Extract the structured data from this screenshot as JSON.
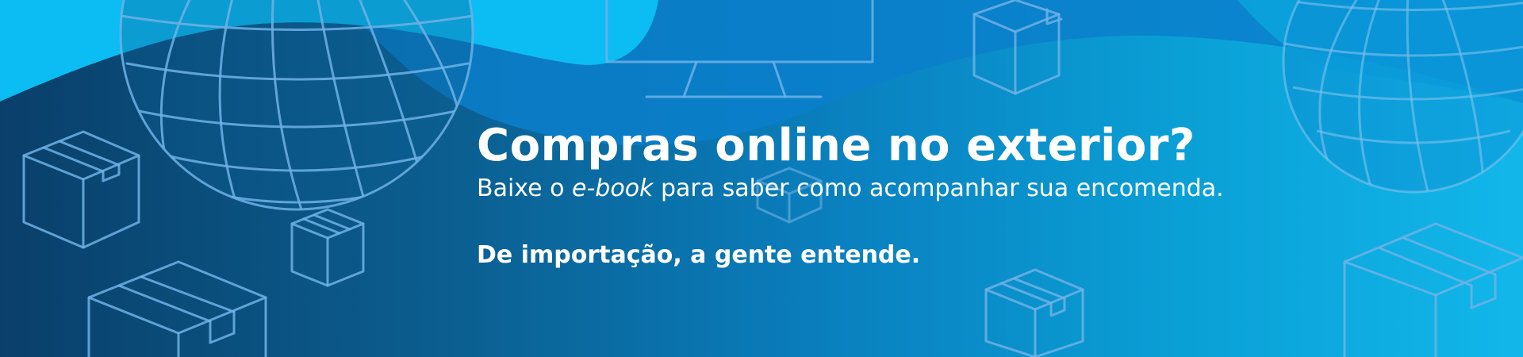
{
  "banner": {
    "headline": "Compras online no exterior?",
    "subtitle": {
      "before": "Baixe o ",
      "emphasis": "e-book",
      "after": " para saber como acompanhar sua encomenda."
    },
    "tagline": "De importação, a gente entende."
  },
  "colors": {
    "bg_left": "#0a3f6a",
    "bg_right": "#12b7ea",
    "wave_light": "#0bbdf3",
    "wave_mid": "#0a7fcb",
    "line_art": "#6fb2e6",
    "text": "#ffffff"
  },
  "icons": [
    "globe-icon",
    "monitor-icon",
    "package-box-icon"
  ]
}
